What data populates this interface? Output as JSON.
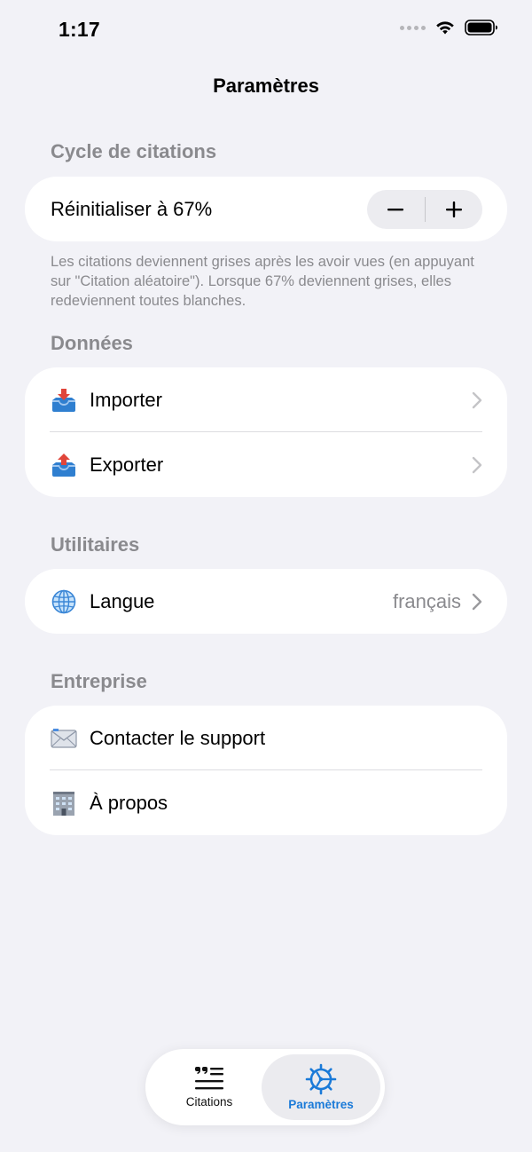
{
  "status_bar": {
    "time": "1:17"
  },
  "nav": {
    "title": "Paramètres"
  },
  "sections": {
    "cycle": {
      "header": "Cycle de citations",
      "reset_label": "Réinitialiser à 67%",
      "stepper_minus": "−",
      "stepper_plus": "+",
      "footnote": "Les citations deviennent grises après les avoir vues (en appuyant sur \"Citation aléatoire\"). Lorsque 67% deviennent grises, elles redeviennent toutes blanches."
    },
    "data": {
      "header": "Données",
      "import_label": "Importer",
      "export_label": "Exporter"
    },
    "utilities": {
      "header": "Utilitaires",
      "language_label": "Langue",
      "language_value": "français"
    },
    "company": {
      "header": "Entreprise",
      "contact_label": "Contacter le support",
      "about_label": "À propos"
    }
  },
  "tabbar": {
    "citations_label": "Citations",
    "params_label": "Paramètres",
    "active_color": "#1a7ad8"
  }
}
